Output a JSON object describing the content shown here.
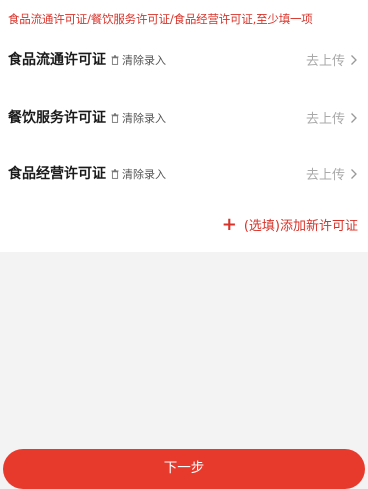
{
  "notice": "食品流通许可证/餐饮服务许可证/食品经营许可证,至少填一项",
  "licenses": [
    {
      "title": "食品流通许可证",
      "clear_label": "清除录入",
      "upload_label": "去上传"
    },
    {
      "title": "餐饮服务许可证",
      "clear_label": "清除录入",
      "upload_label": "去上传"
    },
    {
      "title": "食品经营许可证",
      "clear_label": "清除录入",
      "upload_label": "去上传"
    }
  ],
  "add_license": {
    "icon": "plus-icon",
    "label": "(选填)添加新许可证"
  },
  "next_button": {
    "label": "下一步"
  },
  "colors": {
    "accent": "#e83a2c",
    "notice_text": "#d8332a",
    "muted_text": "#a9a9a9",
    "page_bg": "#f3f3f3"
  },
  "icons": {
    "clear": "trash-icon",
    "upload": "chevron-right-icon"
  }
}
